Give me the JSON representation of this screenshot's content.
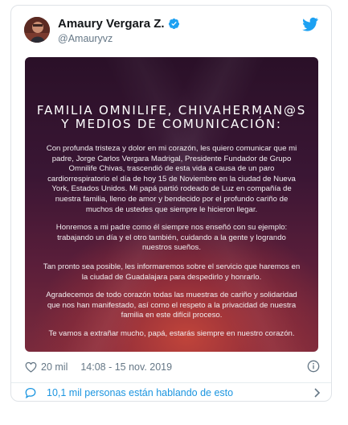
{
  "tweet": {
    "display_name": "Amaury Vergara Z.",
    "handle": "@Amauryvz",
    "likes": "20 mil",
    "timestamp": "14:08 - 15 nov. 2019",
    "conversation": "10,1 mil personas están hablando de esto"
  },
  "image": {
    "title_line1": "FAMILIA OMNILIFE, CHIVAHERMAN@S",
    "title_line2": "Y MEDIOS DE COMUNICACIÓN:",
    "paragraphs": [
      "Con profunda tristeza y dolor en mi corazón, les quiero comunicar que mi padre, Jorge Carlos Vergara Madrigal, Presidente Fundador de Grupo Omnilife Chivas, trascendió de esta vida a causa de un paro cardiorrespiratorio el día de hoy 15 de Noviembre en la ciudad de Nueva York, Estados Unidos. Mi papá partió rodeado de Luz en compañía de nuestra familia, lleno de amor y bendecido por el profundo cariño de muchos de ustedes que siempre le hicieron llegar.",
      "Honremos a mi padre como él siempre nos enseñó con su ejemplo: trabajando un día y el otro también, cuidando a la gente y logrando nuestros sueños.",
      "Tan pronto sea posible, les informaremos sobre el servicio que haremos en la ciudad de Guadalajara para despedirlo y honrarlo.",
      "Agradecemos de todo corazón todas las muestras de cariño y solidaridad que nos han manifestado, así como el respeto a la privacidad de nuestra familia en este difícil proceso.",
      "Te vamos a extrañar mucho, papá, estarás siempre en nuestro corazón."
    ]
  },
  "colors": {
    "twitter_blue": "#1da1f2",
    "link_blue": "#1b95e0",
    "muted_text": "#657786"
  },
  "icons": {
    "verified": "verified-badge-icon",
    "logo": "twitter-bird-icon",
    "like": "heart-icon",
    "info": "info-icon",
    "conversation": "chat-bubble-icon",
    "more": "chevron-right-icon"
  }
}
